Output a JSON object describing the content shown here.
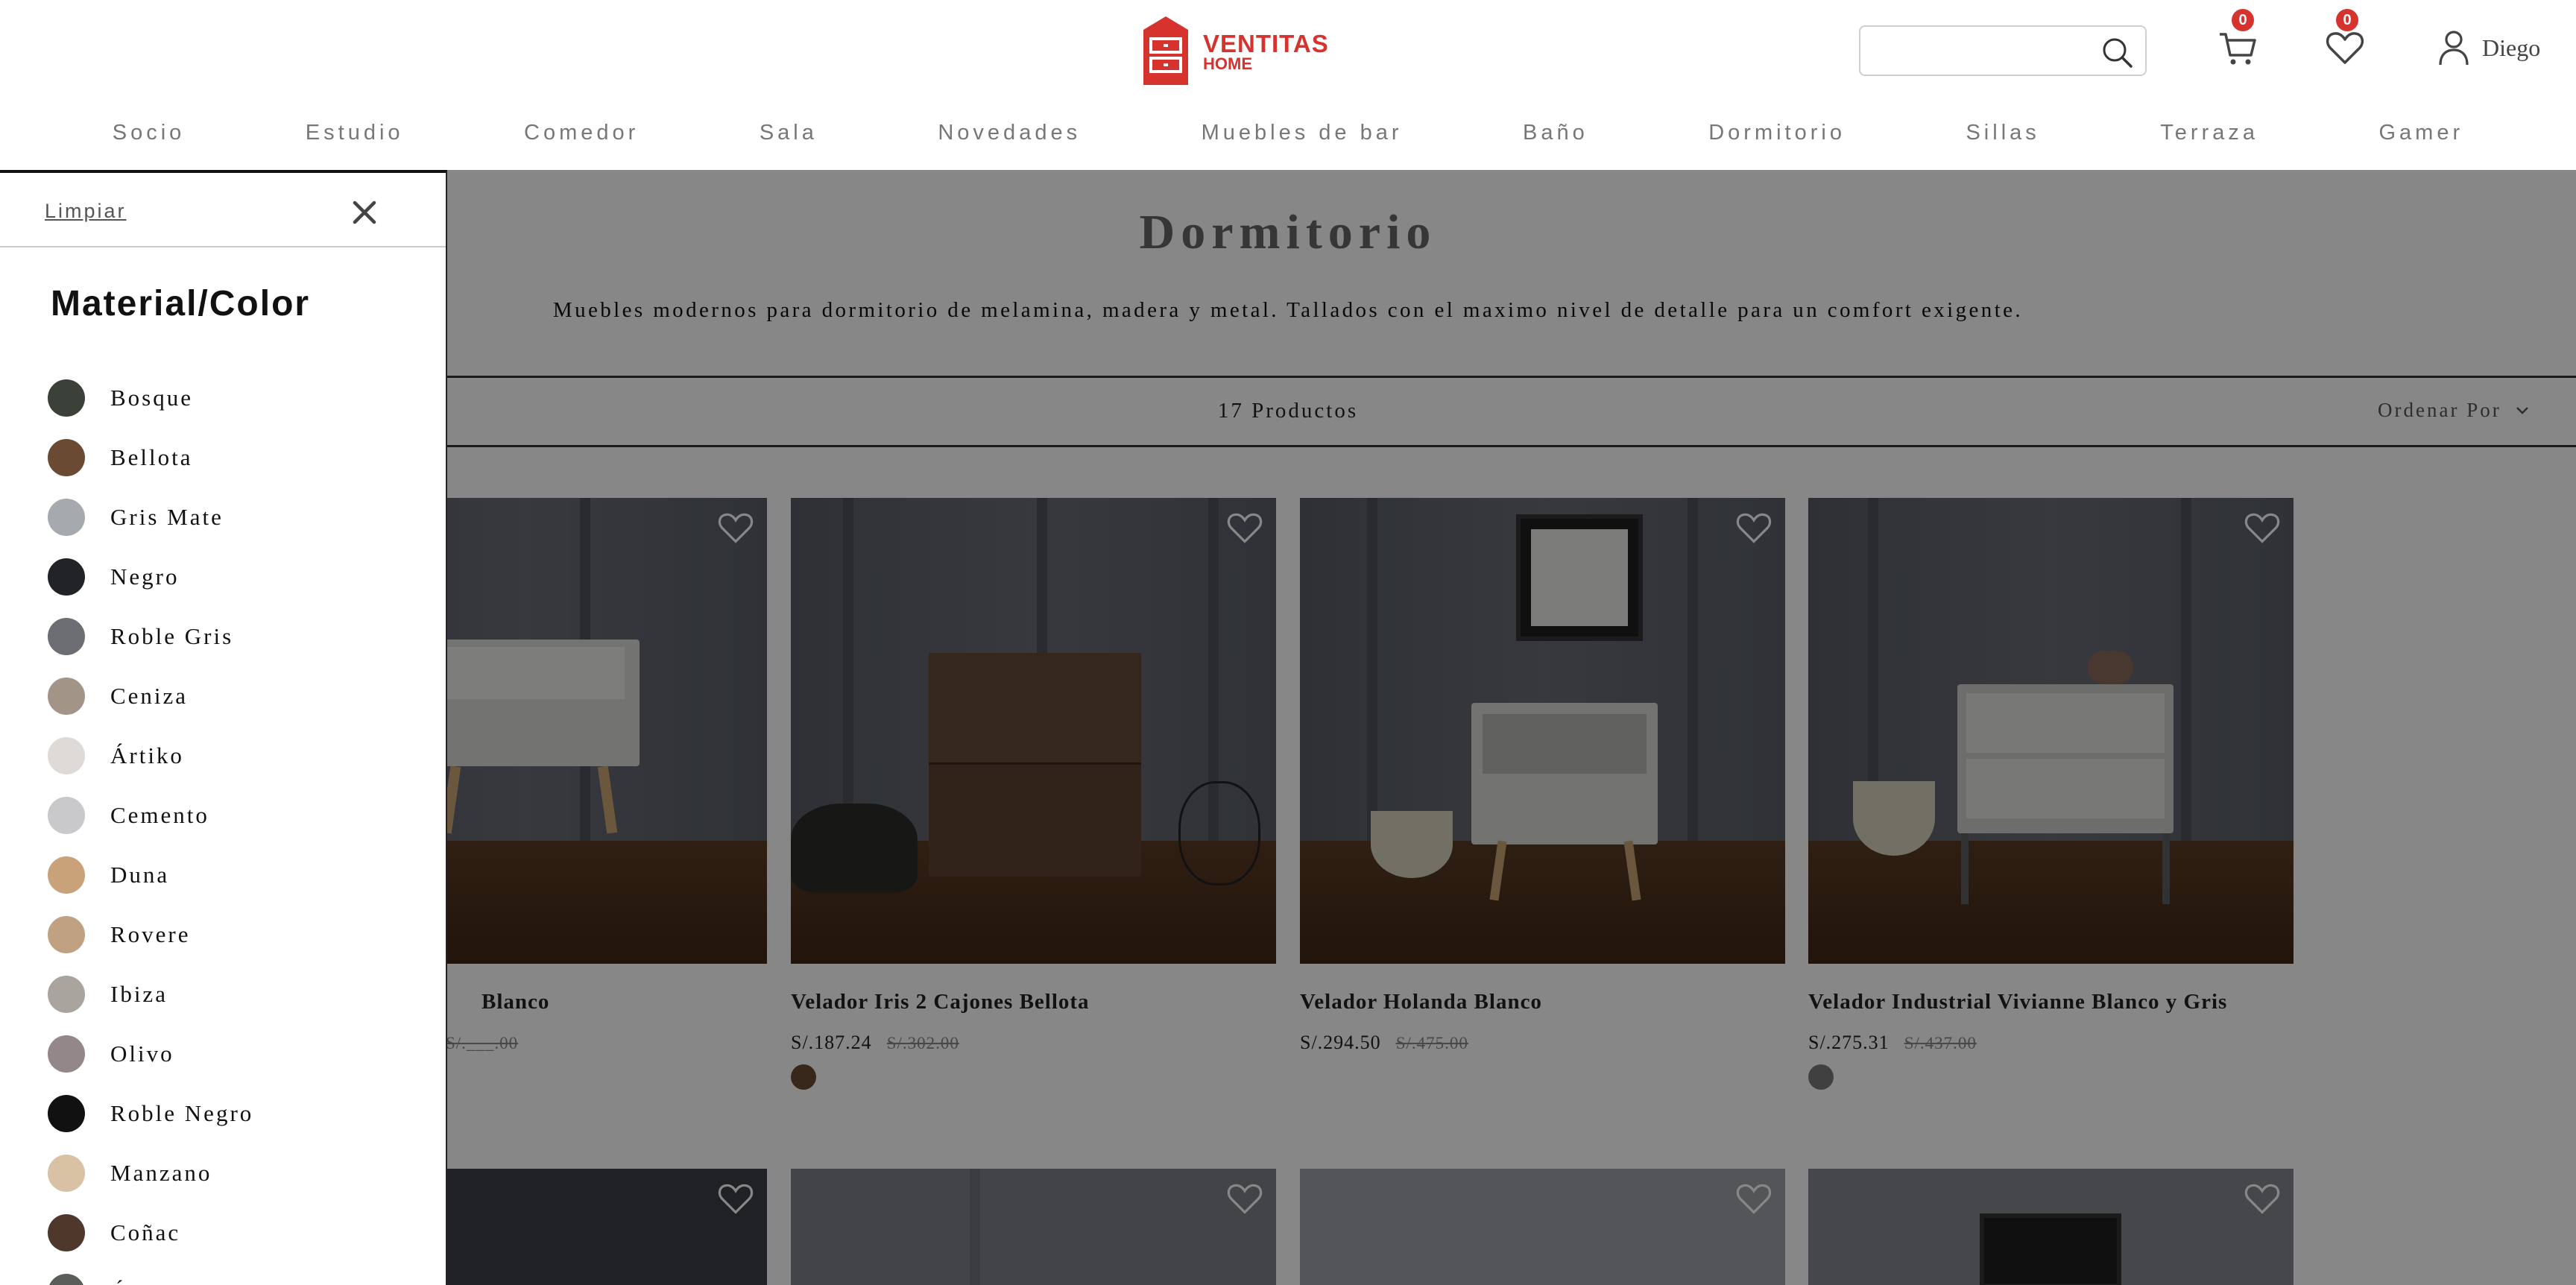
{
  "header": {
    "logo": {
      "main": "VENTITAS",
      "sub": "HOME"
    },
    "search": {
      "value": "",
      "placeholder": ""
    },
    "cart_count": "0",
    "wishlist_count": "0",
    "user_name": "Diego"
  },
  "nav": [
    "Socio",
    "Estudio",
    "Comedor",
    "Sala",
    "Novedades",
    "Muebles de bar",
    "Baño",
    "Dormitorio",
    "Sillas",
    "Terraza",
    "Gamer"
  ],
  "page": {
    "title": "Dormitorio",
    "description": "Muebles modernos para dormitorio de melamina, madera y metal. Tallados con el maximo nivel de detalle para un comfort exigente.",
    "count": "17 Productos",
    "sort_label": "Ordenar Por"
  },
  "products": [
    {
      "name": "Blanco",
      "price": "",
      "old_price": "S/.___.00",
      "swatches": [
        "#ffffff"
      ]
    },
    {
      "name": "Velador Iris 2 Cajones Bellota",
      "price": "S/.187.24",
      "old_price": "S/.302.00",
      "swatches": [
        "#6b4a33"
      ]
    },
    {
      "name": "Velador Holanda Blanco",
      "price": "S/.294.50",
      "old_price": "S/.475.00",
      "swatches": [
        "#ffffff"
      ]
    },
    {
      "name": "Velador Industrial Vivianne Blanco y Gris",
      "price": "S/.275.31",
      "old_price": "S/.437.00",
      "swatches": [
        "#7a7a7a",
        "#ffffff"
      ]
    }
  ],
  "filter": {
    "clear_label": "Limpiar",
    "title": "Material/Color",
    "items": [
      {
        "label": "Bosque",
        "color": "#3b4038"
      },
      {
        "label": "Bellota",
        "color": "#6b4a33"
      },
      {
        "label": "Gris Mate",
        "color": "#a6a9ae"
      },
      {
        "label": "Negro",
        "color": "#222326"
      },
      {
        "label": "Roble Gris",
        "color": "#6d6e73"
      },
      {
        "label": "Ceniza",
        "color": "#a39488"
      },
      {
        "label": "Ártiko",
        "color": "#dddad7"
      },
      {
        "label": "Cemento",
        "color": "#c9c8ca"
      },
      {
        "label": "Duna",
        "color": "#c9a27a"
      },
      {
        "label": "Rovere",
        "color": "#c0a182"
      },
      {
        "label": "Ibiza",
        "color": "#a9a49e"
      },
      {
        "label": "Olivo",
        "color": "#94878a"
      },
      {
        "label": "Roble Negro",
        "color": "#111111"
      },
      {
        "label": "Manzano",
        "color": "#d9c1a4"
      },
      {
        "label": "Coñac",
        "color": "#4e382b"
      },
      {
        "label": "Ónix",
        "color": "#5a5d5a"
      }
    ]
  },
  "colors": {
    "brand": "#d6322e",
    "overlay": "rgba(0,0,0,0.47)"
  }
}
